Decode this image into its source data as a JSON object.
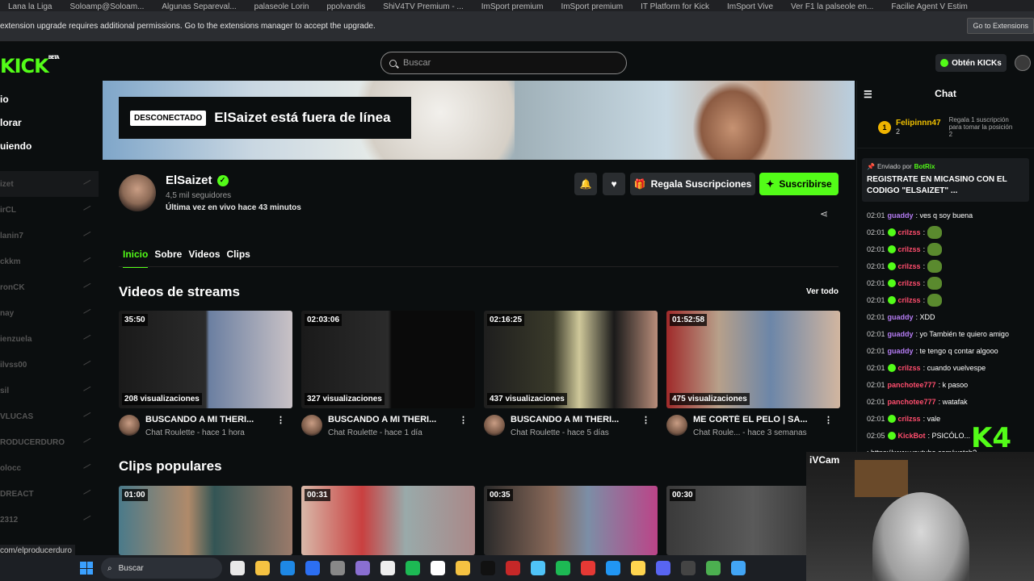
{
  "browser": {
    "bookmarks": [
      "Lana la Liga",
      "Soloamp@Soloam...",
      "Algunas Separeval...",
      "palaseole Lorin",
      "ppolvandis",
      "ShiV4TV Premium - ...",
      "ImSport premium",
      "ImSport premium",
      "IT Platform for Kick",
      "ImSport Vive",
      "Ver F1 la palseole en...",
      "Facilie Agent V Estim"
    ],
    "infobar_message": "extension upgrade requires additional permissions. Go to the extensions manager to accept the upgrade.",
    "infobar_button": "Go to Extensions"
  },
  "header": {
    "logo": "KICK",
    "logo_badge": "BETA",
    "search_placeholder": "Buscar",
    "get_kicks": "Obtén KICKs"
  },
  "sidebar": {
    "nav": [
      "io",
      "lorar",
      "uiendo"
    ],
    "channels": [
      "izet",
      "irCL",
      "lanin7",
      "ckkm",
      "ronCK",
      "nay",
      "ienzuela",
      "ilvss00",
      "sil",
      "VLUCAS",
      "RODUCERDURO",
      "olocc",
      "DREACT",
      "2312"
    ],
    "status_url": "com/elproducerduro"
  },
  "banner": {
    "offline_tag": "DESCONECTADO",
    "offline_text": "ElSaizet está fuera de línea"
  },
  "channel": {
    "name": "ElSaizet",
    "followers": "4,5 mil seguidores",
    "last_live": "Última vez en vivo hace 43 minutos",
    "gift_label": "Regala Suscripciones",
    "subscribe_label": "Suscribirse",
    "tabs": [
      "Inicio",
      "Sobre",
      "Videos",
      "Clips"
    ]
  },
  "streams_section": {
    "title": "Videos de streams",
    "see_all": "Ver todo",
    "videos": [
      {
        "duration": "35:50",
        "views": "208 visualizaciones",
        "title": "BUSCANDO A MI THERI...",
        "category": "Chat Roulette",
        "age": "hace 1 hora"
      },
      {
        "duration": "02:03:06",
        "views": "327 visualizaciones",
        "title": "BUSCANDO A MI THERI...",
        "category": "Chat Roulette",
        "age": "hace 1 día"
      },
      {
        "duration": "02:16:25",
        "views": "437 visualizaciones",
        "title": "BUSCANDO A MI THERI...",
        "category": "Chat Roulette",
        "age": "hace 5 días"
      },
      {
        "duration": "01:52:58",
        "views": "475 visualizaciones",
        "title": "ME CORTÉ EL PELO | SA...",
        "category": "Chat Roule...",
        "age": "hace 3 semanas"
      }
    ]
  },
  "clips_section": {
    "title": "Clips populares",
    "clips": [
      {
        "duration": "01:00"
      },
      {
        "duration": "00:31"
      },
      {
        "duration": "00:35"
      },
      {
        "duration": "00:30"
      }
    ]
  },
  "chat": {
    "title": "Chat",
    "leader_rank": "1",
    "leader_name": "Felipinnn47",
    "leader_count": "2",
    "leader_gift": "Regala 1 suscripción para tomar la posición 2",
    "pinned_by_label": "Enviado por",
    "pinned_by": "BotRix",
    "pinned_text": "REGISTRATE EN MICASINO CON EL CODIGO \"ELSAIZET\" ...",
    "messages": [
      {
        "time": "02:01",
        "user": "guaddy",
        "text": ": ves q soy buena",
        "style": "u1",
        "badge": false,
        "emote": false
      },
      {
        "time": "02:01",
        "user": "crilzss",
        "text": ":",
        "style": "u2",
        "badge": true,
        "emote": true
      },
      {
        "time": "02:01",
        "user": "crilzss",
        "text": ":",
        "style": "u2",
        "badge": true,
        "emote": true
      },
      {
        "time": "02:01",
        "user": "crilzss",
        "text": ":",
        "style": "u2",
        "badge": true,
        "emote": true
      },
      {
        "time": "02:01",
        "user": "crilzss",
        "text": ":",
        "style": "u2",
        "badge": true,
        "emote": true
      },
      {
        "time": "02:01",
        "user": "crilzss",
        "text": ":",
        "style": "u2",
        "badge": true,
        "emote": true
      },
      {
        "time": "02:01",
        "user": "guaddy",
        "text": ": XDD",
        "style": "u1",
        "badge": false,
        "emote": false
      },
      {
        "time": "02:01",
        "user": "guaddy",
        "text": ": yo También te quiero amigo",
        "style": "u1",
        "badge": false,
        "emote": false
      },
      {
        "time": "02:01",
        "user": "guaddy",
        "text": ": te tengo q contar algooo",
        "style": "u1",
        "badge": false,
        "emote": false
      },
      {
        "time": "02:01",
        "user": "crilzss",
        "text": ": cuando vuelvespe",
        "style": "u2",
        "badge": true,
        "emote": false
      },
      {
        "time": "02:01",
        "user": "panchotee777",
        "text": ": k pasoo",
        "style": "u2",
        "badge": false,
        "emote": false
      },
      {
        "time": "02:01",
        "user": "panchotee777",
        "text": ": watafak",
        "style": "u2",
        "badge": false,
        "emote": false
      },
      {
        "time": "02:01",
        "user": "crilzss",
        "text": ": vale",
        "style": "u2",
        "badge": true,
        "emote": false
      },
      {
        "time": "02:05",
        "user": "KickBot",
        "text": ": PSICÓLO...",
        "style": "u2",
        "badge": true,
        "emote": false
      }
    ],
    "last_link": ": https://www.youtube.com/watch?"
  },
  "overlay": {
    "logo": "K4",
    "webcam_label": "iVCam"
  },
  "taskbar": {
    "search_placeholder": "Buscar",
    "icon_colors": [
      "#e8e8e8",
      "#f5c242",
      "#1e88e5",
      "#2c6ff2",
      "#888888",
      "#8a6fd1",
      "#eeeeee",
      "#1db954",
      "#ffffff",
      "#f5c242",
      "#111111",
      "#c62828",
      "#4fc3f7",
      "#1db954",
      "#e53935",
      "#2196f3",
      "#ffd54f",
      "#5865f2",
      "#444444",
      "#4caf50",
      "#42a5f5"
    ]
  }
}
